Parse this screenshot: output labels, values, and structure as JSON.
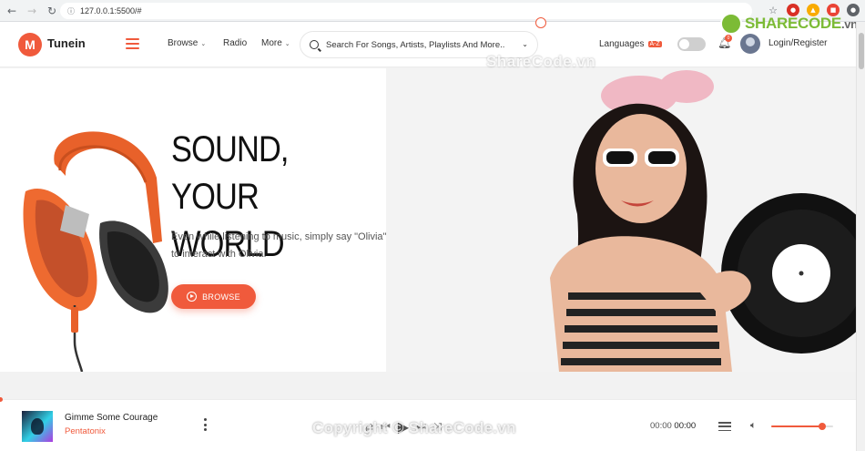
{
  "browser": {
    "url": "127.0.0.1:5500/#",
    "back_icon": "arrow-left",
    "forward_icon": "arrow-right",
    "reload_icon": "reload"
  },
  "header": {
    "logo_letter": "M",
    "brand": "Tunein",
    "menu": [
      {
        "label": "Browse",
        "has_dropdown": true
      },
      {
        "label": "Radio",
        "has_dropdown": false
      },
      {
        "label": "More",
        "has_dropdown": true
      }
    ],
    "search_placeholder": "Search For Songs, Artists, Playlists And More..",
    "languages_label": "Languages",
    "languages_badge": "A-Z",
    "notification_count": "0",
    "login_label": "Login/Register"
  },
  "hero": {
    "title_line1": "SOUND,",
    "title_line2": "YOUR WORLD",
    "subtitle": "Even while listening to music, simply say \"Olivia\" to interact with Olivia.",
    "button_label": "BROWSE",
    "slides": 3,
    "active_slide": 1
  },
  "player": {
    "song_title": "Gimme Some Courage",
    "artist": "Pentatonix",
    "time_current": "00:00",
    "time_total": "00:00",
    "volume": 0.82
  },
  "watermarks": {
    "top": "ShareCode.vn",
    "bottom": "Copyright © ShareCode.vn",
    "logo_main": "SHARECODE",
    "logo_suffix": ".vn"
  },
  "colors": {
    "accent": "#f05a3c",
    "watermark_green": "#7cbb36"
  }
}
